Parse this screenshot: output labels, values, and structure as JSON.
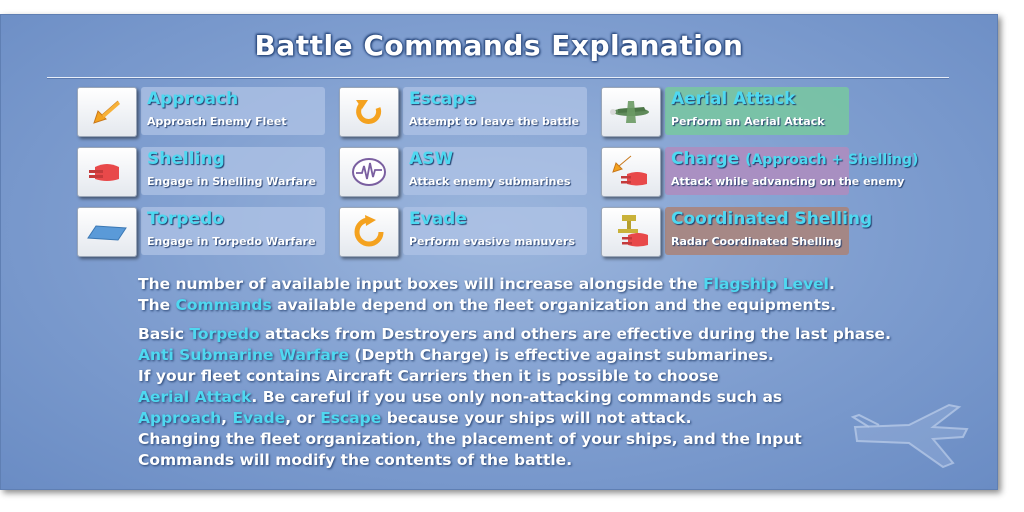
{
  "title": "Battle Commands Explanation",
  "colors": {
    "highlight": "#4fd8f0",
    "panel": "#7e9dcf",
    "text": "#ffffff"
  },
  "commands": [
    {
      "name": "Approach",
      "desc": "Approach Enemy Fleet",
      "icon": "approach-arrow-icon"
    },
    {
      "name": "Escape",
      "desc": "Attempt to leave the battle",
      "icon": "escape-u-turn-icon"
    },
    {
      "name": "Aerial Attack",
      "desc": "Perform an Aerial Attack",
      "icon": "plane-icon"
    },
    {
      "name": "Shelling",
      "desc": "Engage in Shelling Warfare",
      "icon": "cannon-icon"
    },
    {
      "name": "ASW",
      "desc": "Attack enemy submarines",
      "icon": "sonar-icon"
    },
    {
      "name": "Charge",
      "name_sub": "(Approach + Shelling)",
      "desc": "Attack while advancing on the enemy",
      "icon": "charge-icon"
    },
    {
      "name": "Torpedo",
      "desc": "Engage in Torpedo Warfare",
      "icon": "torpedo-icon"
    },
    {
      "name": "Evade",
      "desc": "Perform evasive manuvers",
      "icon": "evade-circle-icon"
    },
    {
      "name": "Coordinated Shelling",
      "desc": "Radar Coordinated Shelling",
      "icon": "radar-cannon-icon"
    }
  ],
  "info": {
    "l1a": "The number of available input boxes will increase alongside the ",
    "l1b": "Flagship Level",
    "l1c": ".",
    "l2a": "The ",
    "l2b": "Commands",
    "l2c": " available depend on the fleet organization and the equipments.",
    "l3a": "Basic ",
    "l3b": "Torpedo",
    "l3c": " attacks from Destroyers and others are effective during the last phase.",
    "l4a": "Anti Submarine Warfare",
    "l4b": " (Depth Charge) is effective against submarines.",
    "l5": "If your fleet contains Aircraft Carriers then it is possible to choose",
    "l6a": "Aerial Attack",
    "l6b": ". Be careful if you use only non-attacking commands such as",
    "l7a": "Approach",
    "l7b": ", ",
    "l7c": "Evade",
    "l7d": ", or ",
    "l7e": "Escape",
    "l7f": " because your ships will not attack.",
    "l8": "Changing the fleet organization, the placement of your ships, and the Input",
    "l9": "Commands will modify the contents of the battle."
  }
}
